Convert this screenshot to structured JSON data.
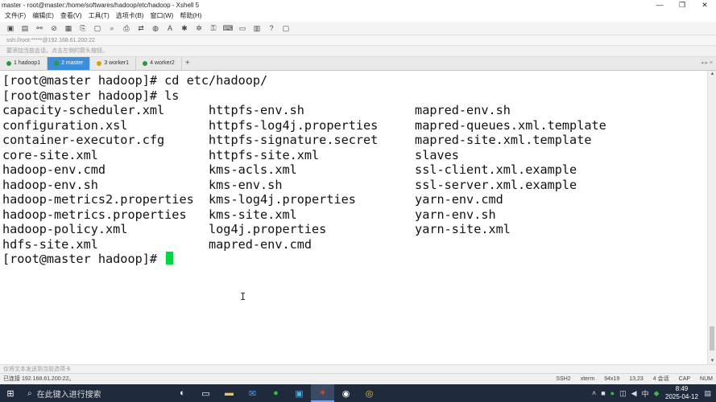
{
  "window": {
    "title": "master - root@master:/home/softwares/hadoop/etc/hadoop - Xshell 5",
    "controls": [
      "—",
      "❐",
      "✕"
    ]
  },
  "menu": [
    "文件(F)",
    "编辑(E)",
    "查看(V)",
    "工具(T)",
    "选项卡(B)",
    "窗口(W)",
    "帮助(H)"
  ],
  "address": "ssh://root:*****@192.168.61.200:22",
  "hint": "要添加当前会话，点击左侧的箭头按钮。",
  "tabs": [
    {
      "label": "1 hadoop1",
      "color": "#2e9b3a",
      "active": false
    },
    {
      "label": "2 master",
      "color": "#2e9b3a",
      "active": true
    },
    {
      "label": "3 worker1",
      "color": "#d9a400",
      "active": false
    },
    {
      "label": "4 worker2",
      "color": "#2e9b3a",
      "active": false
    }
  ],
  "terminal": {
    "lines": [
      "[root@master hadoop]# cd etc/hadoop/",
      "[root@master hadoop]# ls",
      "capacity-scheduler.xml      httpfs-env.sh               mapred-env.sh",
      "configuration.xsl           httpfs-log4j.properties     mapred-queues.xml.template",
      "container-executor.cfg      httpfs-signature.secret     mapred-site.xml.template",
      "core-site.xml               httpfs-site.xml             slaves",
      "hadoop-env.cmd              kms-acls.xml                ssl-client.xml.example",
      "hadoop-env.sh               kms-env.sh                  ssl-server.xml.example",
      "hadoop-metrics2.properties  kms-log4j.properties        yarn-env.cmd",
      "hadoop-metrics.properties   kms-site.xml                yarn-env.sh",
      "hadoop-policy.xml           log4j.properties            yarn-site.xml",
      "hdfs-site.xml               mapred-env.cmd",
      "[root@master hadoop]# "
    ],
    "cursor_color": "#00d63f"
  },
  "compose_hint": "仅将文本发送到当前选项卡",
  "status": {
    "left": "已连接 192.168.61.200:22。",
    "ssh": "SSH2",
    "term": "xterm",
    "size": "94x19",
    "pos": "13,23",
    "sessions": "4 会话",
    "cap": "CAP",
    "num": "NUM"
  },
  "taskbar": {
    "search_text": "在此键入进行搜索",
    "time": "8:49",
    "date": "2025-04-12",
    "ime": "中"
  }
}
